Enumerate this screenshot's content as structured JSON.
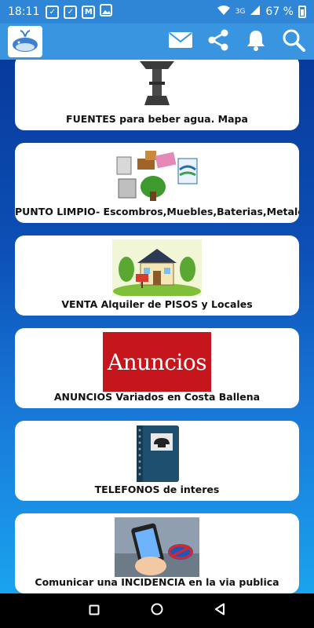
{
  "status_bar": {
    "time": "18:11",
    "icons": [
      "sv-icon",
      "sv-icon",
      "mail-icon",
      "image-icon"
    ],
    "network": "3G",
    "battery": "67 %"
  },
  "app_bar": {
    "logo": "whale-logo",
    "actions": [
      "mail-icon",
      "share-icon",
      "bell-icon",
      "search-icon"
    ]
  },
  "cards": [
    {
      "id": "fuentes",
      "label": "FUENTES para beber agua. Mapa",
      "image": "water-fountain"
    },
    {
      "id": "punto-limpio",
      "label": "PUNTO LIMPIO- Escombros,Muebles,Baterias,Metales..",
      "image": "recycling-items"
    },
    {
      "id": "venta",
      "label": "VENTA Alquiler de PISOS y Locales",
      "image": "house-for-sale"
    },
    {
      "id": "anuncios",
      "label": "ANUNCIOS Variados en Costa Ballena",
      "image": "anuncios-logo",
      "image_text": "Anuncios"
    },
    {
      "id": "telefonos",
      "label": "TELEFONOS de interes",
      "image": "phone-notebook"
    },
    {
      "id": "incidencia",
      "label": "Comunicar una INCIDENCIA en la via publica",
      "image": "phone-photo-sign"
    }
  ],
  "nav_bar": [
    "recent-apps",
    "home",
    "back"
  ],
  "colors": {
    "status_bar": "#2f86d6",
    "app_bar": "#3a95e0",
    "anuncios_red": "#c4161c"
  }
}
